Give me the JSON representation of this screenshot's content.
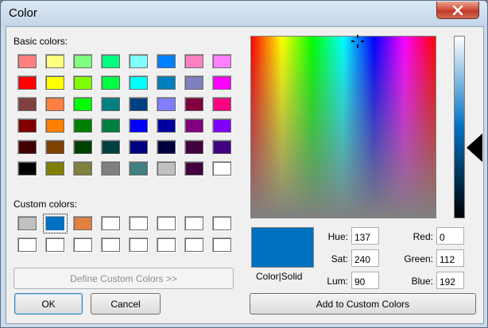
{
  "window": {
    "title": "Color",
    "close_icon": "close-x-icon"
  },
  "basic_colors": {
    "label": "Basic colors:",
    "colors": [
      "#ff8080",
      "#ffff80",
      "#80ff80",
      "#00ff80",
      "#80ffff",
      "#0080ff",
      "#ff80c0",
      "#ff80ff",
      "#ff0000",
      "#ffff00",
      "#80ff00",
      "#00ff40",
      "#00ffff",
      "#0080c0",
      "#8080c0",
      "#ff00ff",
      "#804040",
      "#ff8040",
      "#00ff00",
      "#008080",
      "#004080",
      "#8080ff",
      "#800040",
      "#ff0080",
      "#800000",
      "#ff8000",
      "#008000",
      "#008040",
      "#0000ff",
      "#0000a0",
      "#800080",
      "#8000ff",
      "#400000",
      "#804000",
      "#004000",
      "#004040",
      "#000080",
      "#000040",
      "#400040",
      "#400080",
      "#000000",
      "#808000",
      "#808040",
      "#808080",
      "#408080",
      "#c0c0c0",
      "#400040",
      "#ffffff"
    ]
  },
  "custom_colors": {
    "label": "Custom colors:",
    "colors": [
      "#c0c0c0",
      "#0070c0",
      "#e08040"
    ],
    "selected_index": 1
  },
  "buttons": {
    "define": "Define Custom Colors >>",
    "ok": "OK",
    "cancel": "Cancel",
    "add": "Add to Custom Colors"
  },
  "preview": {
    "label": "Color|Solid",
    "color": "#0070c0"
  },
  "fields": {
    "hue": {
      "label": "Hue:",
      "value": "137"
    },
    "sat": {
      "label": "Sat:",
      "value": "240"
    },
    "lum": {
      "label": "Lum:",
      "value": "90"
    },
    "red": {
      "label": "Red:",
      "value": "0"
    },
    "green": {
      "label": "Green:",
      "value": "112"
    },
    "blue": {
      "label": "Blue:",
      "value": "192"
    }
  }
}
